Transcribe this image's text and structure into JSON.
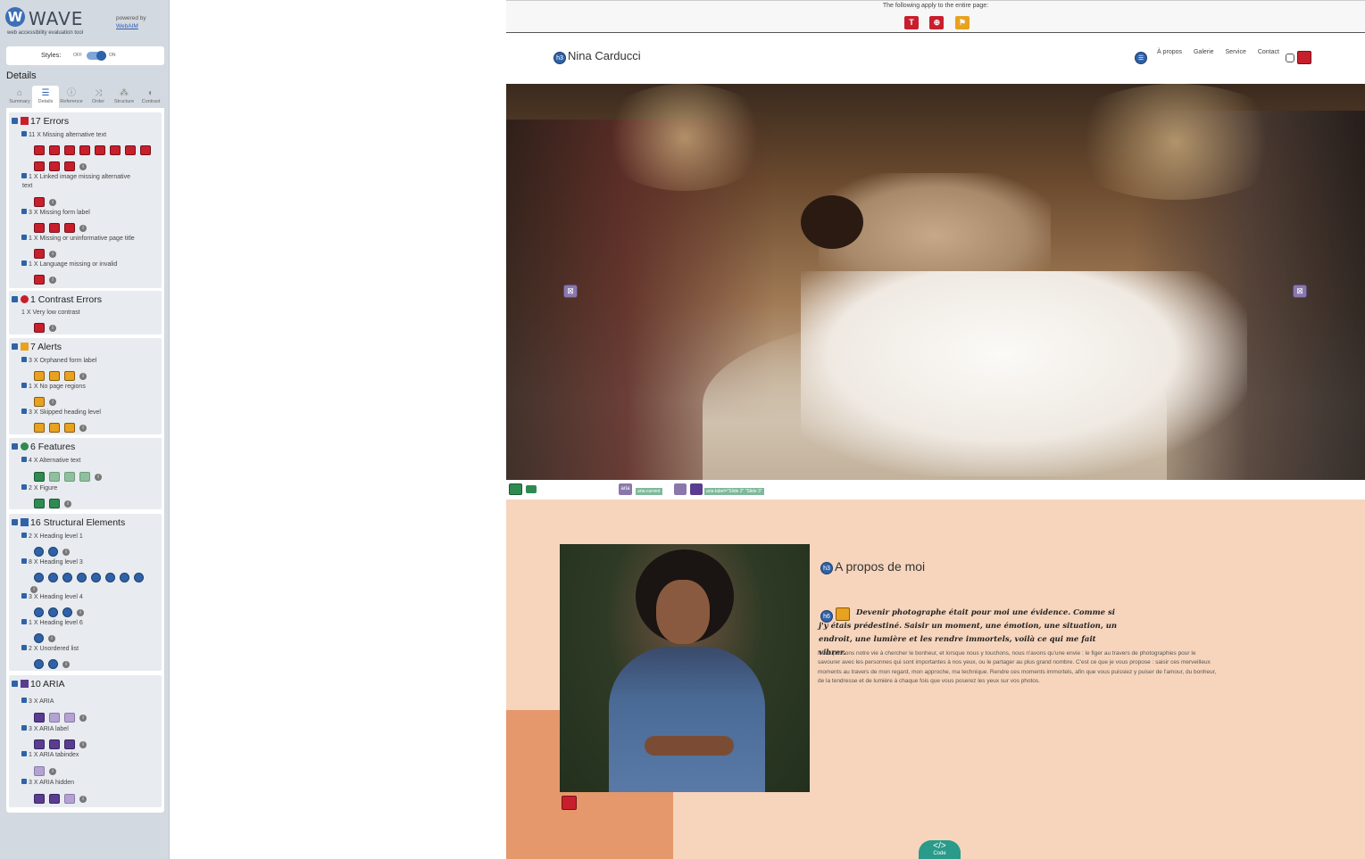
{
  "wave": {
    "logo_letter": "W",
    "logo_text": "WAVE",
    "tagline": "web accessibility evaluation tool",
    "powered_by": "powered by",
    "webaim_link": "WebAIM",
    "styles_label": "Styles:",
    "styles_off": "OFF",
    "styles_on": "ON",
    "details_title": "Details",
    "tabs": [
      {
        "label": "Summary",
        "icon": "home-icon"
      },
      {
        "label": "Details",
        "icon": "list-icon"
      },
      {
        "label": "Reference",
        "icon": "info-icon"
      },
      {
        "label": "Order",
        "icon": "order-icon"
      },
      {
        "label": "Structure",
        "icon": "structure-icon"
      },
      {
        "label": "Contrast",
        "icon": "contrast-icon"
      }
    ],
    "groups": {
      "errors": {
        "title": "17 Errors",
        "items": [
          {
            "label": "11 X Missing alternative text"
          },
          {
            "label": "1 X Linked image missing alternative"
          },
          {
            "label": "3 X Missing form label"
          },
          {
            "label": "1 X Missing or uninformative page title"
          },
          {
            "label": "1 X Language missing or invalid"
          }
        ],
        "linked_image_label_cont": "text"
      },
      "contrast": {
        "title": "1 Contrast Errors",
        "items": [
          {
            "label": "1 X Very low contrast"
          }
        ]
      },
      "alerts": {
        "title": "7 Alerts",
        "items": [
          {
            "label": "3 X Orphaned form label"
          },
          {
            "label": "1 X No page regions"
          },
          {
            "label": "3 X Skipped heading level"
          }
        ]
      },
      "features": {
        "title": "6 Features",
        "items": [
          {
            "label": "4 X Alternative text"
          },
          {
            "label": "2 X Figure"
          }
        ]
      },
      "structure": {
        "title": "16 Structural Elements",
        "items": [
          {
            "label": "2 X Heading level 1"
          },
          {
            "label": "8 X Heading level 3"
          },
          {
            "label": "3 X Heading level 4"
          },
          {
            "label": "1 X Heading level 6"
          },
          {
            "label": "2 X Unordered list"
          }
        ]
      },
      "aria": {
        "title": "10 ARIA",
        "items": [
          {
            "label": "3 X ARIA"
          },
          {
            "label": "3 X ARIA label"
          },
          {
            "label": "1 X ARIA tabindex"
          },
          {
            "label": "3 X ARIA hidden"
          }
        ]
      }
    },
    "colors": {
      "error": "#c81f2d",
      "alert": "#e8a21f",
      "feature": "#2f8a52",
      "structure": "#2f62a8",
      "aria": "#5a3d8f",
      "sidebar_bg": "#d3d9e0"
    }
  },
  "page": {
    "global_notice": "The following apply to the entire page:",
    "global_icons": [
      {
        "icon": "missing-title-error-icon",
        "glyph": "T"
      },
      {
        "icon": "language-error-icon",
        "glyph": "⊕"
      },
      {
        "icon": "no-regions-alert-icon",
        "glyph": "⚑"
      }
    ],
    "h3_badge": "h3",
    "h6_badge": "h6",
    "site_title": "Nina Carducci",
    "nav": [
      "À propos",
      "Galerie",
      "Service",
      "Contact"
    ],
    "hero_arrow_glyph": "⊠",
    "aria_tags": {
      "aria": "aria",
      "current": "aria-current",
      "label": "aria-label=\"Slide 2\"  \"Slide 3\""
    },
    "about_heading": "A propos de moi",
    "quote": "Devenir photographe était pour moi une évidence. Comme si j'y étais prédestiné. Saisir un moment, une émotion, une situation, un endroit, une lumière et les rendre immortels, voilà ce qui me fait vibrer.",
    "body": "Nous passons notre vie à chercher le bonheur, et lorsque nous y touchons, nous n'avons qu'une envie : le figer au travers de photographies pour le savourer avec les personnes qui sont importantes à nos yeux, ou le partager au plus grand nombre. C'est ce que je vous propose : saisir ces merveilleux moments au travers de mon regard, mon approche, ma technique. Rendre ces moments immortels, afin que vous puissiez y puiser de l'amour, du bonheur, de la tendresse et de lumière à chaque fois que vous poserez les yeux sur vos photos.",
    "code_tab_glyph": "</>",
    "code_tab_label": "Code"
  }
}
